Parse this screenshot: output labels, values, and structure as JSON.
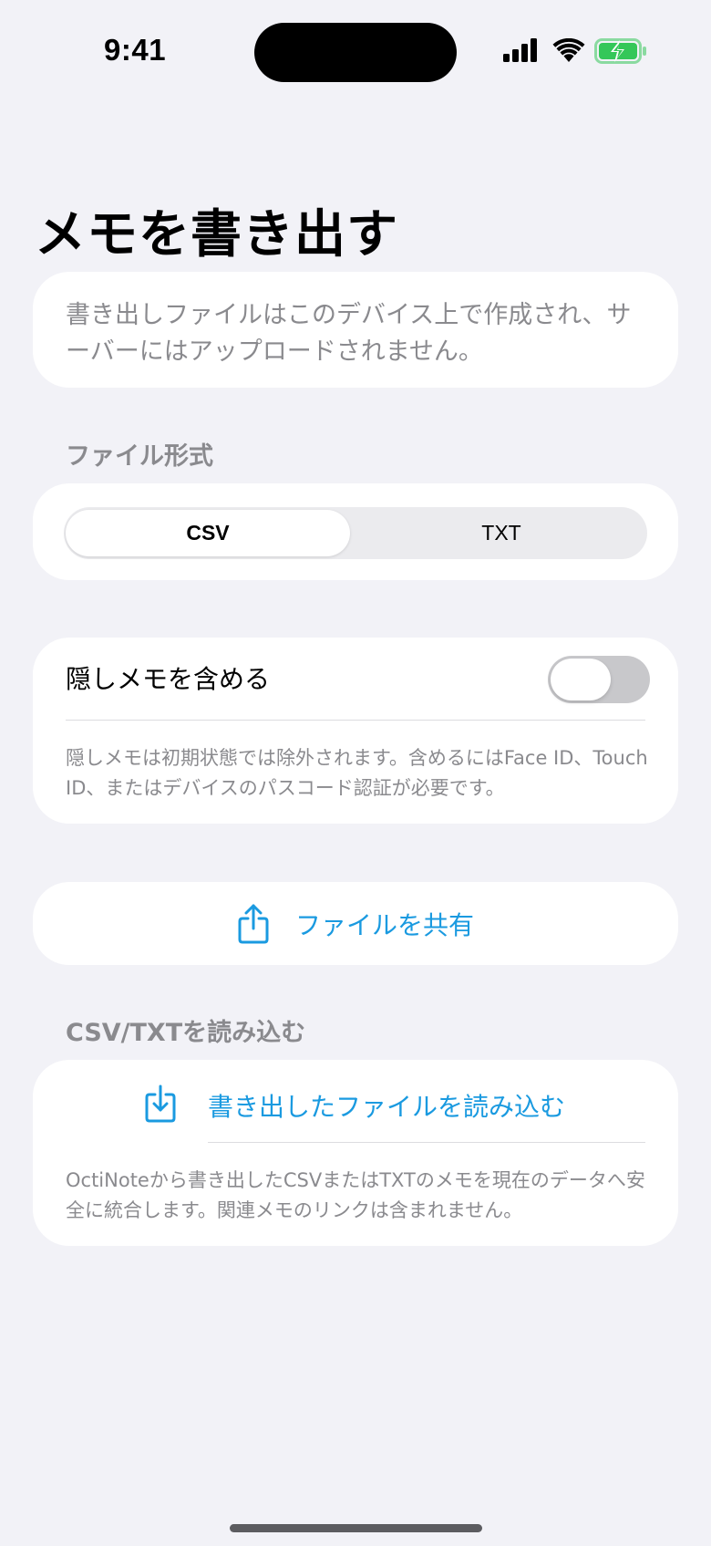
{
  "status_bar": {
    "time": "9:41",
    "icons": [
      "cellular-signal-icon",
      "wifi-icon",
      "battery-charging-icon"
    ],
    "battery_color": "#34c759"
  },
  "title": "メモを書き出す",
  "info": {
    "text": "書き出しファイルはこのデバイス上で作成され、サーバーにはアップロードされません。"
  },
  "file_format": {
    "section_label": "ファイル形式",
    "options": [
      "CSV",
      "TXT"
    ],
    "selected": "CSV"
  },
  "hidden_memos": {
    "label": "隠しメモを含める",
    "enabled": false,
    "note": "隠しメモは初期状態では除外されます。含めるにはFace ID、Touch ID、またはデバイスのパスコード認証が必要です。"
  },
  "share": {
    "label": "ファイルを共有",
    "icon": "share-icon"
  },
  "import": {
    "section_label": "CSV/TXTを読み込む",
    "button_label": "書き出したファイルを読み込む",
    "icon": "import-icon",
    "note": "OctiNoteから書き出したCSVまたはTXTのメモを現在のデータへ安全に統合します。関連メモのリンクは含まれません。"
  },
  "colors": {
    "accent": "#1a9ae0",
    "background": "#f2f2f7",
    "secondary_text": "#8a8a8e"
  }
}
